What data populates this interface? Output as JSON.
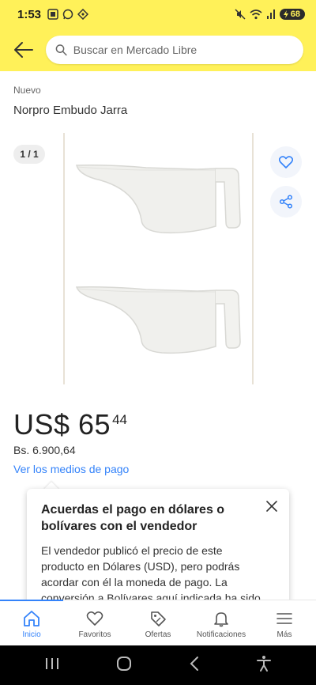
{
  "status_bar": {
    "time": "1:53",
    "battery": "68"
  },
  "header": {
    "search_placeholder": "Buscar en Mercado Libre"
  },
  "product": {
    "condition": "Nuevo",
    "title": "Norpro Embudo Jarra",
    "image_counter": "1 / 1",
    "price_currency_main": "US$ 65",
    "price_cents": "44",
    "price_local": "Bs. 6.900,64",
    "payment_link": "Ver los medios de pago"
  },
  "tooltip": {
    "title": "Acuerdas el pago en dólares o bolívares con el vendedor",
    "body": "El vendedor publicó el precio de este producto en Dólares (USD), pero podrás acordar con él la moneda de pago. La conversión a Bolívares aquí indicada ha sido"
  },
  "bottom_nav": {
    "items": [
      {
        "label": "Inicio",
        "icon": "home-icon",
        "active": true
      },
      {
        "label": "Favoritos",
        "icon": "heart-icon",
        "active": false
      },
      {
        "label": "Ofertas",
        "icon": "tag-icon",
        "active": false
      },
      {
        "label": "Notificaciones",
        "icon": "bell-icon",
        "active": false
      },
      {
        "label": "Más",
        "icon": "menu-icon",
        "active": false
      }
    ]
  },
  "colors": {
    "brand_yellow": "#fff159",
    "link_blue": "#3483fa"
  }
}
